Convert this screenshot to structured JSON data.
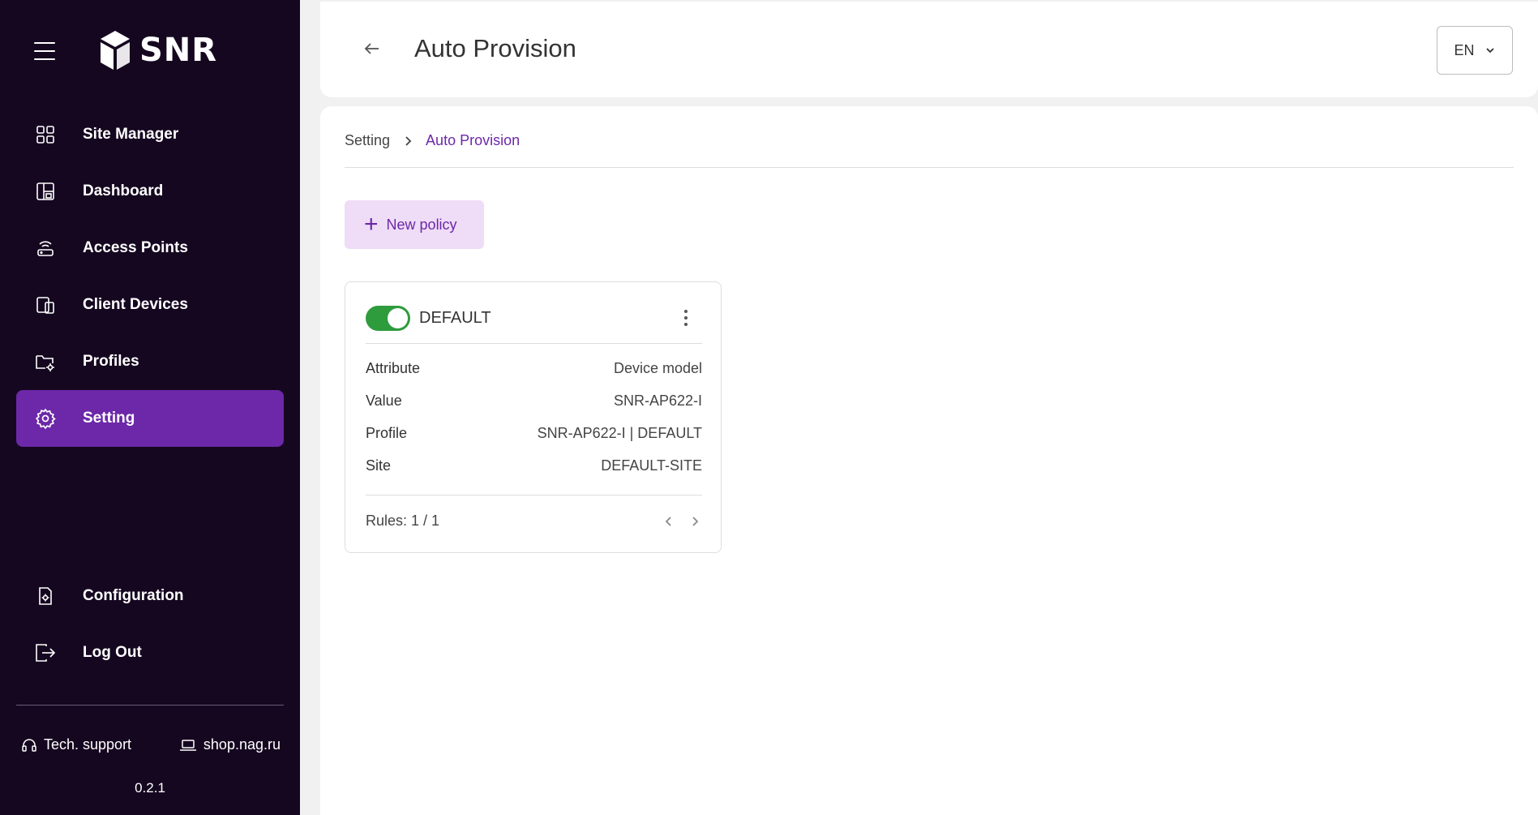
{
  "sidebar": {
    "logo_text": "SNR",
    "nav": [
      {
        "label": "Site Manager",
        "icon": "grid-icon"
      },
      {
        "label": "Dashboard",
        "icon": "dashboard-icon"
      },
      {
        "label": "Access Points",
        "icon": "router-icon"
      },
      {
        "label": "Client Devices",
        "icon": "devices-icon"
      },
      {
        "label": "Profiles",
        "icon": "folder-settings-icon"
      },
      {
        "label": "Setting",
        "icon": "gear-icon",
        "active": true
      }
    ],
    "bottom_nav": [
      {
        "label": "Configuration",
        "icon": "config-file-icon"
      },
      {
        "label": "Log Out",
        "icon": "logout-icon"
      }
    ],
    "tech_support": "Tech. support",
    "shop": "shop.nag.ru",
    "version": "0.2.1"
  },
  "header": {
    "title": "Auto Provision",
    "language": "EN"
  },
  "breadcrumb": {
    "parent": "Setting",
    "current": "Auto Provision"
  },
  "new_policy_label": "New policy",
  "policy": {
    "name": "DEFAULT",
    "enabled": true,
    "rows": [
      {
        "key": "Attribute",
        "value": "Device model"
      },
      {
        "key": "Value",
        "value": "SNR-AP622-I"
      },
      {
        "key": "Profile",
        "value": "SNR-AP622-I | DEFAULT"
      },
      {
        "key": "Site",
        "value": "DEFAULT-SITE"
      }
    ],
    "rules": "Rules: 1 / 1"
  },
  "colors": {
    "sidebar_bg": "#150720",
    "accent": "#6c28a8",
    "toggle_on": "#2e9b3d",
    "button_bg": "#efdcf7"
  }
}
